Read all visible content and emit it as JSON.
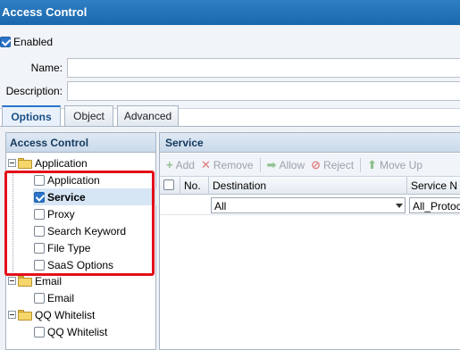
{
  "window": {
    "title": "Access Control"
  },
  "form": {
    "enabled_label": "Enabled",
    "enabled_checked": true,
    "name_label": "Name:",
    "name_value": "",
    "description_label": "Description:",
    "description_value": ""
  },
  "tabs": [
    {
      "label": "Options",
      "active": true
    },
    {
      "label": "Object",
      "active": false
    },
    {
      "label": "Advanced",
      "active": false
    }
  ],
  "left_panel": {
    "title": "Access Control",
    "tree": [
      {
        "label": "Application",
        "type": "folder"
      },
      {
        "label": "Application",
        "type": "checkbox",
        "checked": false
      },
      {
        "label": "Service",
        "type": "checkbox",
        "checked": true,
        "selected": true
      },
      {
        "label": "Proxy",
        "type": "checkbox",
        "checked": false
      },
      {
        "label": "Search Keyword",
        "type": "checkbox",
        "checked": false
      },
      {
        "label": "File Type",
        "type": "checkbox",
        "checked": false
      },
      {
        "label": "SaaS Options",
        "type": "checkbox",
        "checked": false
      },
      {
        "label": "Email",
        "type": "folder"
      },
      {
        "label": "Email",
        "type": "checkbox",
        "checked": false
      },
      {
        "label": "QQ Whitelist",
        "type": "folder"
      },
      {
        "label": "QQ Whitelist",
        "type": "checkbox",
        "checked": false
      }
    ]
  },
  "right_panel": {
    "title": "Service",
    "toolbar": {
      "add": "Add",
      "remove": "Remove",
      "allow": "Allow",
      "reject": "Reject",
      "move_up": "Move Up"
    },
    "columns": {
      "no": "No.",
      "destination": "Destination",
      "service": "Service N"
    },
    "row": {
      "destination": "All",
      "service": "All_Protoc"
    }
  },
  "colors": {
    "title_bar": "#1a67ad",
    "highlight": "#e3101a",
    "accent": "#2a74c9"
  }
}
